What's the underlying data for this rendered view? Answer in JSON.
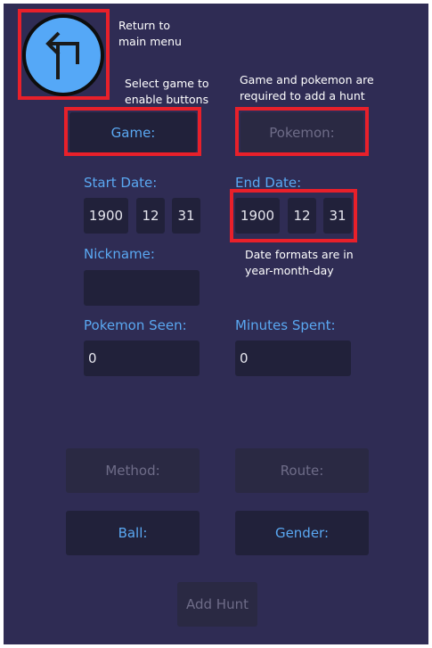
{
  "annotations": {
    "back": [
      "Return to",
      "main menu"
    ],
    "select_game": [
      "Select game to",
      "enable buttons"
    ],
    "required": [
      "Game and pokemon are",
      "required to add a hunt"
    ],
    "date_format": [
      "Date formats are in",
      "year-month-day"
    ]
  },
  "back_button": {
    "icon": "turn-left-arrow-icon",
    "color": "#55a8f7"
  },
  "buttons": {
    "game": "Game:",
    "pokemon": "Pokemon:",
    "method": "Method:",
    "route": "Route:",
    "ball": "Ball:",
    "gender": "Gender:",
    "add_hunt": "Add Hunt"
  },
  "start_date": {
    "label": "Start Date:",
    "year": "1900",
    "month": "12",
    "day": "31"
  },
  "end_date": {
    "label": "End Date:",
    "year": "1900",
    "month": "12",
    "day": "31"
  },
  "nickname": {
    "label": "Nickname:",
    "value": ""
  },
  "pokemon_seen": {
    "label": "Pokemon Seen:",
    "value": "0"
  },
  "minutes_spent": {
    "label": "Minutes Spent:",
    "value": "0"
  },
  "colors": {
    "background": "#2f2c54",
    "accent": "#5aa8f2",
    "highlight": "#e8202a"
  }
}
